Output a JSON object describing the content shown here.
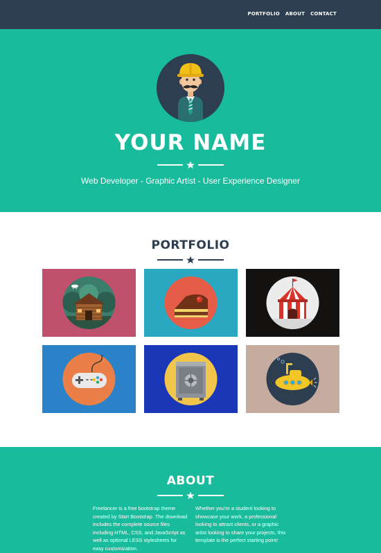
{
  "nav": {
    "items": [
      {
        "label": "PORTFOLIO"
      },
      {
        "label": "ABOUT"
      },
      {
        "label": "CONTACT"
      }
    ]
  },
  "hero": {
    "name": "YOUR NAME",
    "skills": "Web Developer - Graphic Artist - User Experience Designer"
  },
  "portfolio": {
    "title": "PORTFOLIO",
    "items": [
      {
        "icon": "cabin-icon",
        "bg": "#c0516c"
      },
      {
        "icon": "cake-icon",
        "bg": "#2aa8c2"
      },
      {
        "icon": "circus-tent-icon",
        "bg": "#141111"
      },
      {
        "icon": "game-controller-icon",
        "bg": "#2b82c9"
      },
      {
        "icon": "safe-icon",
        "bg": "#1a37b8"
      },
      {
        "icon": "submarine-icon",
        "bg": "#c6ab9f"
      }
    ]
  },
  "about": {
    "title": "ABOUT",
    "col1": "Freelancer is a free bootstrap theme created by Start Bootstrap. The download includes the complete source files including HTML, CSS, and JavaScript as well as optional LESS stylesheets for easy customization.",
    "col2": "Whether you're a student looking to showcase your work, a professional looking to attract clients, or a graphic artist looking to share your projects, this template is the perfect starting point!"
  },
  "colors": {
    "primary": "#18bc9c",
    "dark": "#2c3e50",
    "white": "#ffffff"
  }
}
